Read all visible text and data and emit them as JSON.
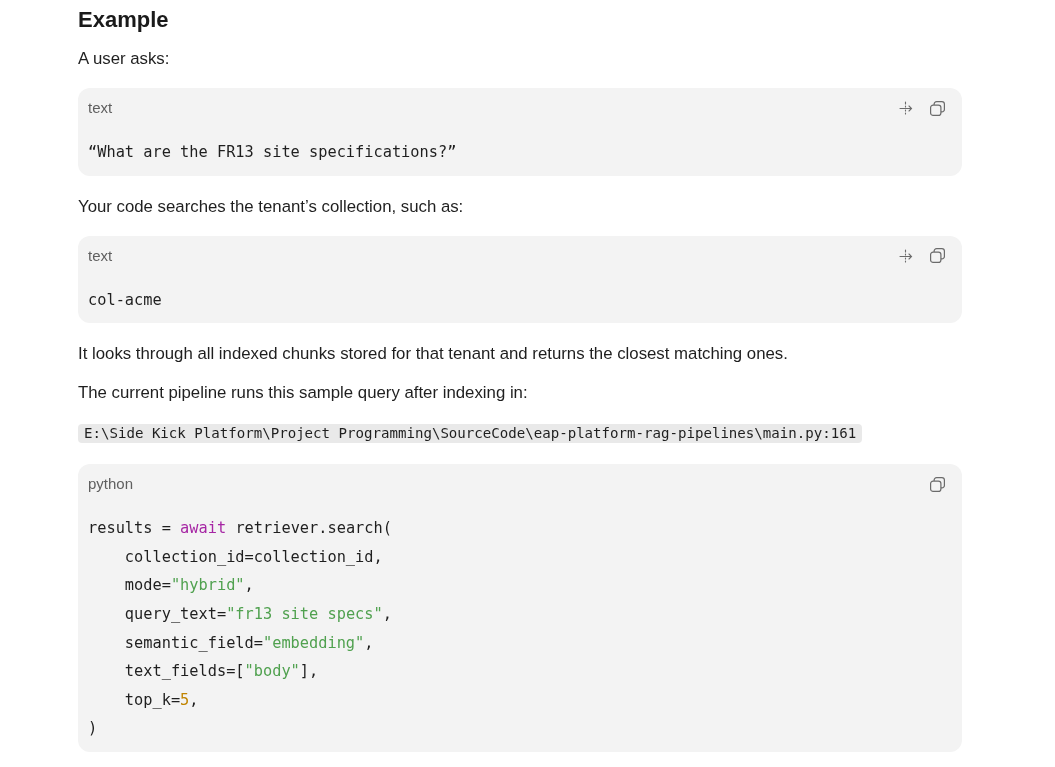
{
  "content": [
    {
      "kind": "heading",
      "text": "Example"
    },
    {
      "kind": "paragraph",
      "text": "A user asks:"
    },
    {
      "kind": "code_block",
      "language": "text",
      "wrap_button": true,
      "lines": [
        [
          {
            "kind": "plain",
            "text": "“What are the FR13 site specifications?”"
          }
        ]
      ]
    },
    {
      "kind": "paragraph",
      "text": "Your code searches the tenant’s collection, such as:"
    },
    {
      "kind": "code_block",
      "language": "text",
      "wrap_button": true,
      "lines": [
        [
          {
            "kind": "plain",
            "text": "col-acme"
          }
        ]
      ]
    },
    {
      "kind": "paragraph",
      "text": "It looks through all indexed chunks stored for that tenant and returns the closest matching ones."
    },
    {
      "kind": "paragraph",
      "text": "The current pipeline runs this sample query after indexing in:"
    },
    {
      "kind": "inline_code",
      "text": "E:\\Side Kick Platform\\Project Programming\\SourceCode\\eap-platform-rag-pipelines\\main.py:161"
    },
    {
      "kind": "code_block",
      "language": "python",
      "wrap_button": false,
      "lines": [
        [
          {
            "kind": "plain",
            "text": "results = "
          },
          {
            "kind": "keyword",
            "text": "await"
          },
          {
            "kind": "plain",
            "text": " retriever.search("
          }
        ],
        [
          {
            "kind": "plain",
            "text": "    collection_id=collection_id,"
          }
        ],
        [
          {
            "kind": "plain",
            "text": "    mode="
          },
          {
            "kind": "string",
            "text": "\"hybrid\""
          },
          {
            "kind": "plain",
            "text": ","
          }
        ],
        [
          {
            "kind": "plain",
            "text": "    query_text="
          },
          {
            "kind": "string",
            "text": "\"fr13 site specs\""
          },
          {
            "kind": "plain",
            "text": ","
          }
        ],
        [
          {
            "kind": "plain",
            "text": "    semantic_field="
          },
          {
            "kind": "string",
            "text": "\"embedding\""
          },
          {
            "kind": "plain",
            "text": ","
          }
        ],
        [
          {
            "kind": "plain",
            "text": "    text_fields=["
          },
          {
            "kind": "string",
            "text": "\"body\""
          },
          {
            "kind": "plain",
            "text": "],"
          }
        ],
        [
          {
            "kind": "plain",
            "text": "    top_k="
          },
          {
            "kind": "number",
            "text": "5"
          },
          {
            "kind": "plain",
            "text": ","
          }
        ],
        [
          {
            "kind": "plain",
            "text": ")"
          }
        ]
      ]
    }
  ]
}
